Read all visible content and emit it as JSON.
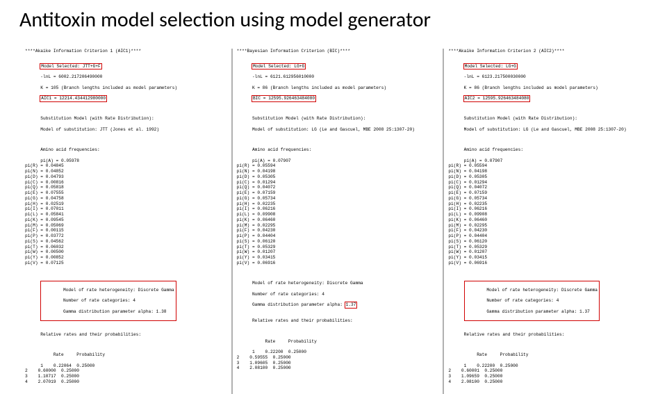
{
  "title": "Antitoxin model selection using model generator",
  "panels": [
    {
      "criterion_header": "****Akaike Information Criterion 1 (AIC1)****",
      "selected_model_line": "Model Selected: JTT+G+F",
      "lnL_line": "-lnL = 6002.217206490000",
      "K_line": "K = 105 (Branch lengths included as model parameters)",
      "aic_line": "AIC1 = 12214.434412980000",
      "subst_header": "Substitution Model (with Rate Distribution):",
      "subst_detail": "Model of substitution: JTT (Jones et al. 1992)",
      "freq_header": "Amino acid frequencies:",
      "freqs": [
        "pi(A) = 0.05978",
        "pi(R) = 0.04845",
        "pi(N) = 0.04852",
        "pi(D) = 0.04793",
        "pi(C) = 0.00816",
        "pi(Q) = 0.05818",
        "pi(E) = 0.07555",
        "pi(G) = 0.04758",
        "pi(H) = 0.02519",
        "pi(I) = 0.07011",
        "pi(L) = 0.05841",
        "pi(K) = 0.09545",
        "pi(M) = 0.05069",
        "pi(F) = 0.00115",
        "pi(P) = 0.03772",
        "pi(S) = 0.04562",
        "pi(T) = 0.06032",
        "pi(W) = 0.00500",
        "pi(Y) = 0.00852",
        "pi(V) = 0.07125"
      ],
      "rate_model_header": "Model of rate heterogeneity: Discrete Gamma",
      "rate_categories": "Number of rate categories: 4",
      "gamma_line": "Gamma distribution parameter alpha: 1.38",
      "rel_rates_header": "Relative rates and their probabilities:",
      "rates_table_header": "     Rate     Probability",
      "rates_table": [
        "1    0.22064  0.25000",
        "2    0.60000  0.25000",
        "3    1.10717  0.25000",
        "4    2.07019  0.25000"
      ]
    },
    {
      "criterion_header": "****Bayesian Information Criterion (BIC)****",
      "selected_model_line": "Model Selected: LG+G",
      "lnL_line": "-lnL = 6121.612956010000",
      "K_line": "K = 86 (Branch lengths included as model parameters)",
      "aic_line": "BIC = 12595.926463484080",
      "subst_header": "Substitution Model (with Rate Distribution):",
      "subst_detail": "Model of substitution: LG (Le and Gascuel, MBE 2008 25:1307-20)",
      "freq_header": "Amino acid frequencies:",
      "freqs": [
        "pi(A) = 0.07907",
        "pi(R) = 0.05594",
        "pi(N) = 0.04198",
        "pi(D) = 0.05305",
        "pi(C) = 0.01294",
        "pi(Q) = 0.04072",
        "pi(E) = 0.07159",
        "pi(G) = 0.05734",
        "pi(H) = 0.02235",
        "pi(I) = 0.06216",
        "pi(L) = 0.09908",
        "pi(K) = 0.06460",
        "pi(M) = 0.02295",
        "pi(F) = 0.04230",
        "pi(P) = 0.04404",
        "pi(S) = 0.06120",
        "pi(T) = 0.05329",
        "pi(W) = 0.01207",
        "pi(Y) = 0.03415",
        "pi(V) = 0.06916"
      ],
      "rate_model_header": "Model of rate heterogeneity: Discrete Gamma",
      "rate_categories": "Number of rate categories: 4",
      "gamma_line": "Gamma distribution parameter alpha: 1.37",
      "rel_rates_header": "Relative rates and their probabilities:",
      "rates_table_header": "     Rate     Probability",
      "rates_table": [
        "1    0.22200  0.25000",
        "2    0.59555  0.25000",
        "3    1.09605  0.25000",
        "4    2.08100  0.25000"
      ]
    },
    {
      "criterion_header": "****Akaike Information Criterion 2 (AIC2)****",
      "selected_model_line": "Model Selected: LG+G",
      "lnL_line": "-lnL = 6123.217500030000",
      "K_line": "K = 86 (Branch lengths included as model parameters)",
      "aic_line": "AIC2 = 12595.926463484080",
      "subst_header": "Substitution Model (with Rate Distribution):",
      "subst_detail": "Model of substitution: LG (Le and Gascuel, MBE 2008 25:1307-20)",
      "freq_header": "Amino acid frequencies:",
      "freqs": [
        "pi(A) = 0.07907",
        "pi(R) = 0.05594",
        "pi(N) = 0.04198",
        "pi(D) = 0.05305",
        "pi(C) = 0.01294",
        "pi(Q) = 0.04072",
        "pi(E) = 0.07159",
        "pi(G) = 0.05734",
        "pi(H) = 0.02235",
        "pi(I) = 0.06216",
        "pi(L) = 0.09908",
        "pi(K) = 0.06460",
        "pi(M) = 0.02295",
        "pi(F) = 0.04230",
        "pi(P) = 0.04404",
        "pi(S) = 0.06120",
        "pi(T) = 0.05329",
        "pi(W) = 0.01207",
        "pi(Y) = 0.03415",
        "pi(V) = 0.06916"
      ],
      "rate_model_header": "Model of rate heterogeneity: Discrete Gamma",
      "rate_categories": "Number of rate categories: 4",
      "gamma_line": "Gamma distribution parameter alpha: 1.37",
      "rel_rates_header": "Relative rates and their probabilities:",
      "rates_table_header": "     Rate     Probability",
      "rates_table": [
        "1    0.22200  0.25000",
        "2    0.60001  0.25000",
        "3    1.09659  0.25000",
        "4    2.08100  0.25000"
      ]
    }
  ]
}
